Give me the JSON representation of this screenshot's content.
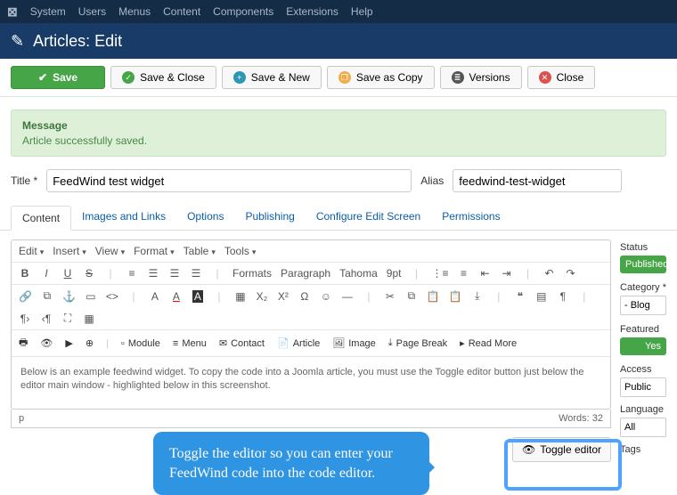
{
  "topmenu": [
    "System",
    "Users",
    "Menus",
    "Content",
    "Components",
    "Extensions",
    "Help"
  ],
  "header": {
    "title": "Articles: Edit"
  },
  "actions": {
    "save": "Save",
    "saveClose": "Save & Close",
    "saveNew": "Save & New",
    "saveCopy": "Save as Copy",
    "versions": "Versions",
    "close": "Close"
  },
  "message": {
    "title": "Message",
    "body": "Article successfully saved."
  },
  "form": {
    "titleLabel": "Title *",
    "titleValue": "FeedWind test widget",
    "aliasLabel": "Alias",
    "aliasValue": "feedwind-test-widget"
  },
  "tabs": [
    "Content",
    "Images and Links",
    "Options",
    "Publishing",
    "Configure Edit Screen",
    "Permissions"
  ],
  "editor": {
    "menu": [
      "Edit",
      "Insert",
      "View",
      "Format",
      "Table",
      "Tools"
    ],
    "fontDrop": "Formats",
    "paraDrop": "Paragraph",
    "fontName": "Tahoma",
    "fontSize": "9pt",
    "modules": [
      "Module",
      "Menu",
      "Contact",
      "Article",
      "Image",
      "Page Break",
      "Read More"
    ],
    "body": "Below is an example feedwind widget. To copy the code into a Joomla article, you must use the Toggle editor button just below the editor main window - highlighted below in this screenshot.",
    "pathLabel": "p",
    "wordsLabel": "Words: 32",
    "toggleLabel": "Toggle editor"
  },
  "sidebar": {
    "statusLabel": "Status",
    "statusValue": "Published",
    "categoryLabel": "Category *",
    "categoryValue": "- Blog",
    "featuredLabel": "Featured",
    "featuredValue": "Yes",
    "accessLabel": "Access",
    "accessValue": "Public",
    "languageLabel": "Language",
    "languageValue": "All",
    "tagsLabel": "Tags"
  },
  "callout": "Toggle the editor so you can enter your FeedWind code into the code editor."
}
